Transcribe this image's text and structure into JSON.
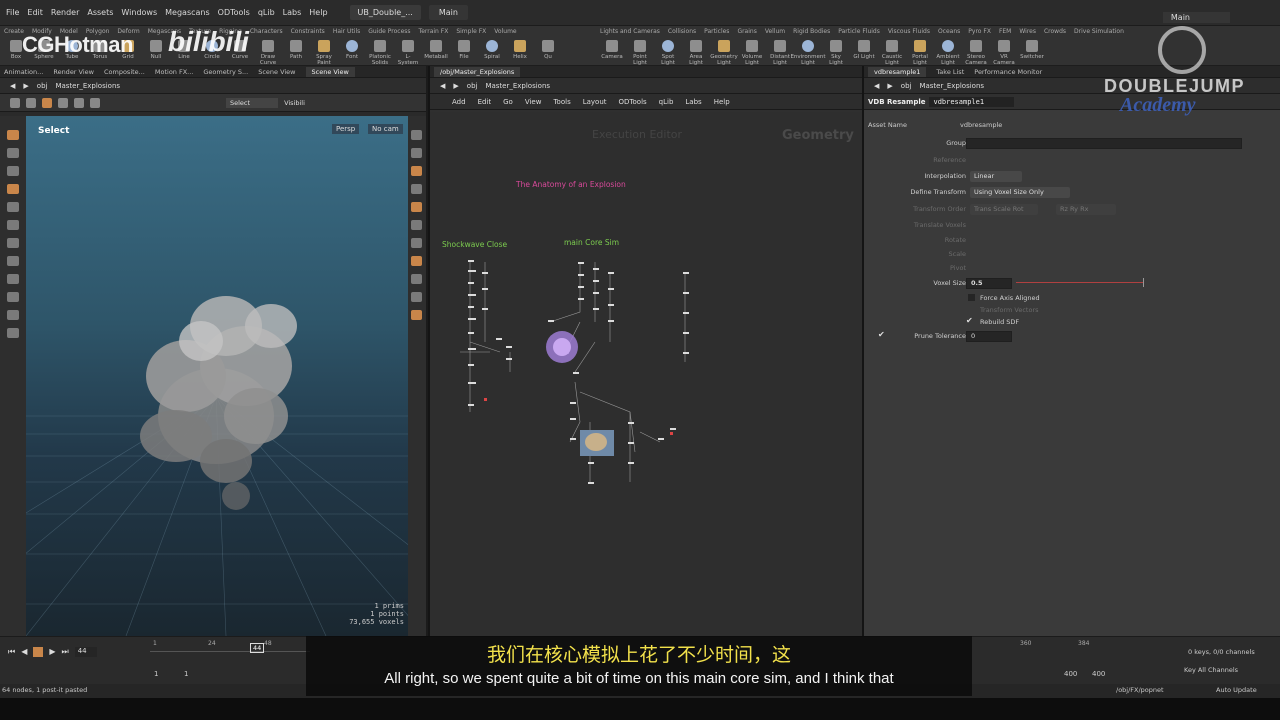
{
  "menubar": {
    "items": [
      "File",
      "Edit",
      "Render",
      "Assets",
      "Windows",
      "Megascans",
      "ODTools",
      "qLib",
      "Labs",
      "Help"
    ],
    "desktop_tab": "UB_Double_...",
    "desktop_name": "Main",
    "desktop_right": "Main"
  },
  "shelf": {
    "tabs_left": [
      "Create",
      "Modify",
      "Model",
      "Polygon",
      "Deform",
      "Megascans",
      "Texture",
      "Rigging",
      "Characters",
      "Constraints",
      "Hair Utils",
      "Guide Process",
      "Terrain FX",
      "Simple FX",
      "Volume"
    ],
    "tools_left": [
      "Box",
      "Sphere",
      "Tube",
      "Torus",
      "Grid",
      "Null",
      "Line",
      "Circle",
      "Curve",
      "Draw Curve",
      "Path",
      "Spray Paint",
      "Font",
      "Platonic Solids",
      "L-System",
      "Metaball",
      "File",
      "Spiral",
      "Helix",
      "Qu"
    ],
    "tabs_right": [
      "Lights and Cameras",
      "Collisions",
      "Particles",
      "Grains",
      "Vellum",
      "Rigid Bodies",
      "Particle Fluids",
      "Viscous Fluids",
      "Oceans",
      "Pyro FX",
      "FEM",
      "Wires",
      "Crowds",
      "Drive Simulation"
    ],
    "tools_right": [
      "Camera",
      "Point Light",
      "Spot Light",
      "Area Light",
      "Geometry Light",
      "Volume Light",
      "Distant Light",
      "Environment Light",
      "Sky Light",
      "GI Light",
      "Caustic Light",
      "Portal Light",
      "Ambient Light",
      "Stereo Camera",
      "VR Camera",
      "Switcher"
    ]
  },
  "left_pane": {
    "tabs": [
      "Animation...",
      "Render View",
      "Composite...",
      "Motion FX...",
      "Geometry S...",
      "Scene View",
      "Scene View"
    ],
    "path_root": "obj",
    "path_node": "Master_Explosions",
    "select_dropdown": "Select",
    "visibility_label": "Visibili",
    "mode_label": "Select",
    "persp": "Persp",
    "cam": "No cam",
    "stats": [
      "1  prims",
      "1  points",
      "73,655 voxels"
    ]
  },
  "center_pane": {
    "tabs": [
      "/obj/Master_Explosions"
    ],
    "path_root": "obj",
    "path_node": "Master_Explosions",
    "menu": [
      "Add",
      "Edit",
      "Go",
      "View",
      "Tools",
      "Layout",
      "ODTools",
      "qLib",
      "Labs",
      "Help"
    ],
    "watermark_editor": "Execution Editor",
    "watermark_context": "Geometry",
    "sticky_title": "The Anatomy of an Explosion",
    "label_shockwave": "Shockwave Close",
    "label_maincore": "main Core Sim"
  },
  "right_pane": {
    "tabs": [
      "vdbresample1",
      "Take List",
      "Performance Monitor"
    ],
    "path_root": "obj",
    "path_node": "Master_Explosions",
    "node_type": "VDB Resample",
    "node_name": "vdbresample1",
    "asset_name_label": "Asset Name",
    "asset_name_value": "vdbresample",
    "params": {
      "group_label": "Group",
      "reference_label": "Reference",
      "interpolation_label": "Interpolation",
      "interpolation_value": "Linear",
      "define_transform_label": "Define Transform",
      "define_transform_value": "Using Voxel Size Only",
      "transform_order_label": "Transform Order",
      "transform_order_value": "Trans Scale Rot",
      "rot_order_value": "Rz Ry Rx",
      "translate_voxels_label": "Translate Voxels",
      "rotate_label": "Rotate",
      "scale_label": "Scale",
      "pivot_label": "Pivot",
      "voxel_size_label": "Voxel Size",
      "voxel_size_value": "0.5",
      "force_axis_label": "Force Axis Aligned",
      "transform_vectors_label": "Transform Vectors",
      "rebuild_sdf_label": "Rebuild SDF",
      "prune_label": "Prune Tolerance",
      "prune_value": "0"
    }
  },
  "timeline": {
    "current_frame": "44",
    "marker": "44",
    "ticks": [
      "1",
      "24",
      "48",
      "360",
      "384"
    ],
    "start": "1",
    "start2": "1",
    "end": "400",
    "end2": "400",
    "keys_info": "0 keys, 0/0 channels",
    "key_all": "Key All Channels",
    "auto_update": "Auto Update",
    "net_path": "/obj/FX/popnet"
  },
  "status": {
    "message": "64 nodes, 1 post-it pasted"
  },
  "subtitles": {
    "chinese": "我们在核心模拟上花了不少时间，这",
    "english": "All right, so we spent quite a bit of time on this main core sim, and I think that"
  },
  "watermarks": {
    "cghotman": "CGHotman",
    "bilibili": "bilibili",
    "doublejump": "DOUBLEJUMP",
    "academy": "Academy"
  },
  "colors": {
    "accent_orange": "#c9864a",
    "sticky_pink": "#d84a9a",
    "label_green": "#7ccc4f",
    "subtitle_yellow": "#f2e14b"
  }
}
